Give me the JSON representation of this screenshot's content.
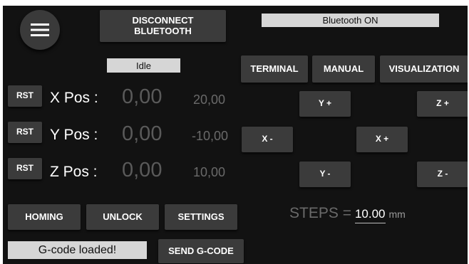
{
  "header": {
    "disconnect_label": "DISCONNECT\nBLUETOOTH",
    "bluetooth_status": "Bluetooth ON",
    "menu_icon": "hamburger-menu-icon"
  },
  "status": {
    "machine_state": "Idle",
    "gcode_status": "G-code loaded!"
  },
  "tabs": {
    "terminal": "TERMINAL",
    "manual": "MANUAL",
    "visualization": "VISUALIZATION"
  },
  "axes": [
    {
      "reset_label": "RST",
      "label": "X Pos :",
      "value": "0,00",
      "target": "20,00"
    },
    {
      "reset_label": "RST",
      "label": "Y Pos :",
      "value": "0,00",
      "target": "-10,00"
    },
    {
      "reset_label": "RST",
      "label": "Z Pos :",
      "value": "0,00",
      "target": "10,00"
    }
  ],
  "jog": {
    "y_plus": "Y +",
    "y_minus": "Y -",
    "x_plus": "X +",
    "x_minus": "X -",
    "z_plus": "Z +",
    "z_minus": "Z -"
  },
  "steps": {
    "label": "STEPS =",
    "value": "10.00",
    "unit": "mm"
  },
  "actions": {
    "homing": "HOMING",
    "unlock": "UNLOCK",
    "settings": "SETTINGS",
    "send_gcode": "SEND G-CODE"
  },
  "colors": {
    "background": "#121212",
    "button": "#3b3b3b",
    "status_box": "#d6d6d6",
    "value_text": "#5a5a5a"
  }
}
